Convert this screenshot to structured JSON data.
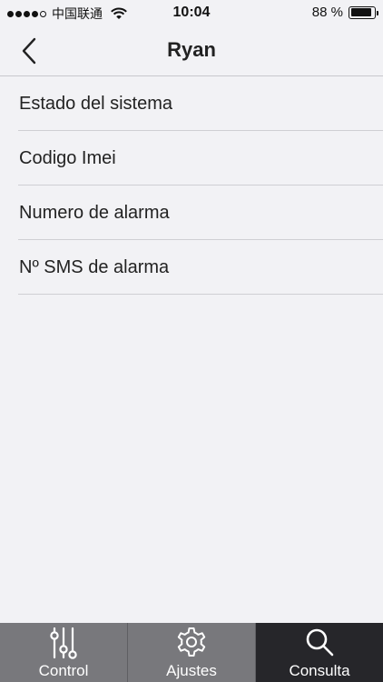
{
  "status_bar": {
    "carrier": "中国联通",
    "time": "10:04",
    "battery_text": "88 %",
    "battery_level": 0.88,
    "signal_bars_filled": 4,
    "signal_bars_total": 5
  },
  "nav": {
    "title": "Ryan",
    "back_icon": "chevron-left-icon"
  },
  "menu": {
    "items": [
      {
        "label": "Estado del sistema"
      },
      {
        "label": "Codigo Imei"
      },
      {
        "label": "Numero de alarma"
      },
      {
        "label": "Nº SMS de alarma"
      }
    ]
  },
  "tabs": {
    "items": [
      {
        "label": "Control",
        "icon": "sliders-icon",
        "active": false
      },
      {
        "label": "Ajustes",
        "icon": "gear-icon",
        "active": false
      },
      {
        "label": "Consulta",
        "icon": "search-icon",
        "active": true
      }
    ]
  },
  "colors": {
    "background": "#f2f2f5",
    "tab_inactive": "#78787c",
    "tab_active": "#26262a"
  }
}
